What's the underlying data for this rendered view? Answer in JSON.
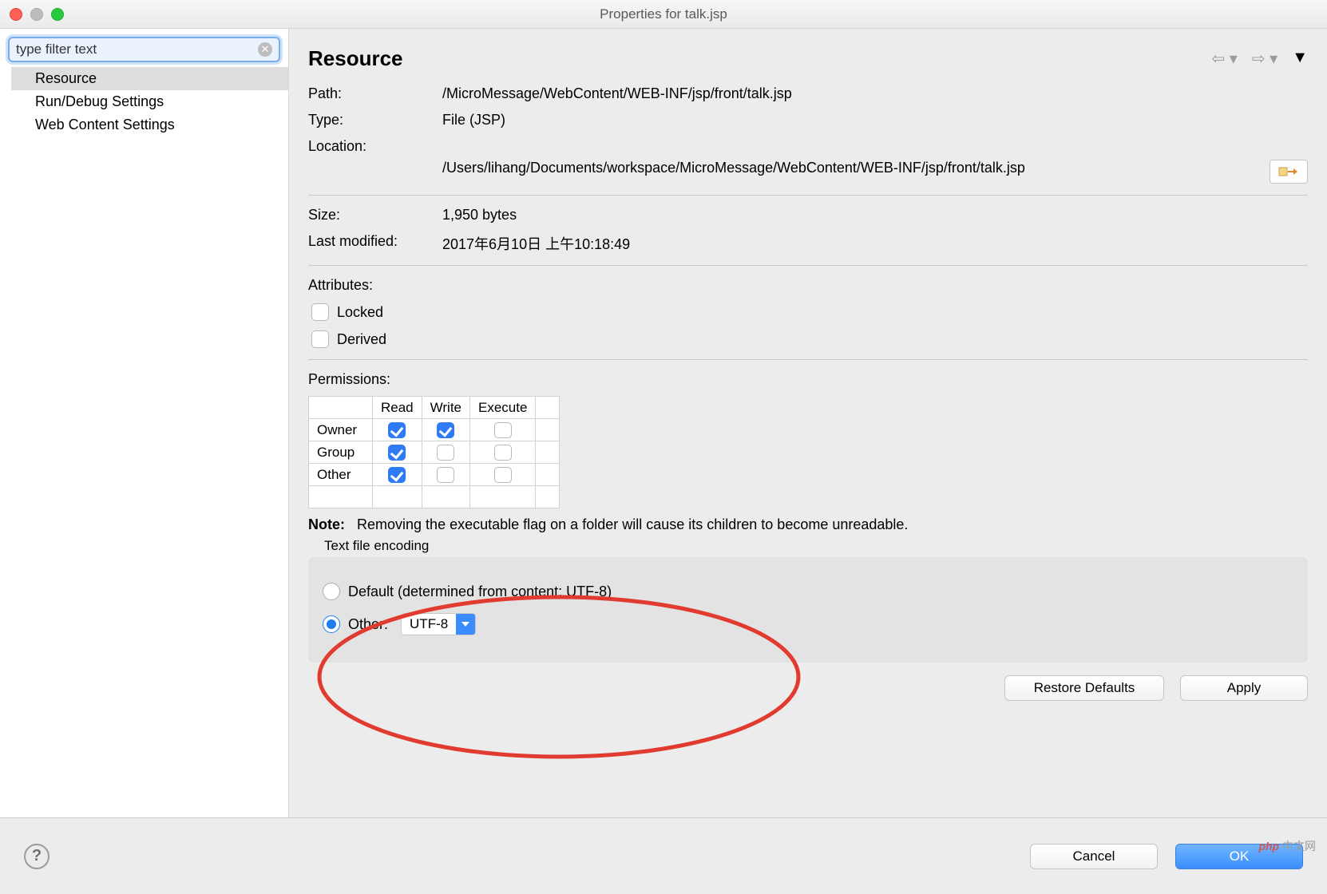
{
  "window": {
    "title": "Properties for talk.jsp"
  },
  "sidebar": {
    "filter_placeholder": "type filter text",
    "filter_value": "type filter text",
    "items": [
      {
        "label": "Resource",
        "selected": true
      },
      {
        "label": "Run/Debug Settings",
        "selected": false
      },
      {
        "label": "Web Content Settings",
        "selected": false
      }
    ]
  },
  "main": {
    "title": "Resource",
    "info": {
      "path_label": "Path:",
      "path": "/MicroMessage/WebContent/WEB-INF/jsp/front/talk.jsp",
      "type_label": "Type:",
      "type": "File  (JSP)",
      "location_label": "Location:",
      "location": "/Users/lihang/Documents/workspace/MicroMessage/WebContent/WEB-INF/jsp/front/talk.jsp",
      "size_label": "Size:",
      "size": "1,950  bytes",
      "modified_label": "Last modified:",
      "modified": "2017年6月10日 上午10:18:49"
    },
    "attributes": {
      "title": "Attributes:",
      "locked": "Locked",
      "derived": "Derived"
    },
    "permissions": {
      "title": "Permissions:",
      "cols": [
        "",
        "Read",
        "Write",
        "Execute"
      ],
      "rows": [
        {
          "label": "Owner",
          "read": true,
          "write": true,
          "execute": false
        },
        {
          "label": "Group",
          "read": true,
          "write": false,
          "execute": false
        },
        {
          "label": "Other",
          "read": true,
          "write": false,
          "execute": false
        }
      ]
    },
    "note_label": "Note:",
    "note_text": "Removing the executable flag on a folder will cause its children to become unreadable.",
    "encoding": {
      "legend": "Text file encoding",
      "default_label": "Default (determined from content: UTF-8)",
      "other_label": "Other:",
      "other_value": "UTF-8",
      "selected": "other"
    },
    "restore_defaults": "Restore Defaults",
    "apply": "Apply"
  },
  "footer": {
    "cancel": "Cancel",
    "ok": "OK"
  },
  "watermark": {
    "brand": "php",
    "text": "中文网"
  }
}
